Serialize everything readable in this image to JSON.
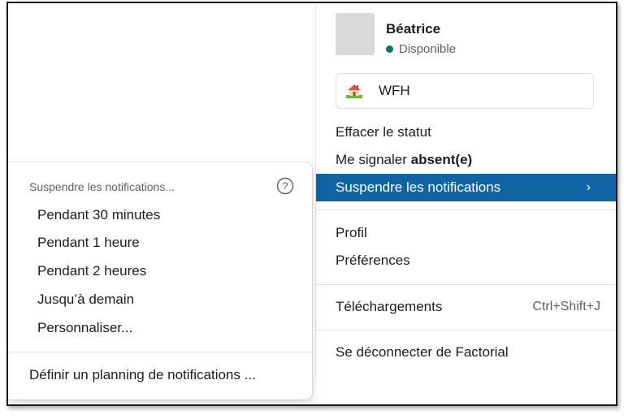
{
  "profile": {
    "name": "Béatrice",
    "presence": "Disponible",
    "presence_color": "#007a5a"
  },
  "status": {
    "emoji_icon": "house-emoji-icon",
    "text": "WFH"
  },
  "menu": {
    "clear_status": "Effacer le statut",
    "set_away_prefix": "Me signaler ",
    "set_away_bold": "absent(e)",
    "pause_notifications": "Suspendre les notifications",
    "profile": "Profil",
    "preferences": "Préférences",
    "downloads": "Téléchargements",
    "downloads_shortcut": "Ctrl+Shift+J",
    "sign_out": "Se déconnecter de Factorial"
  },
  "submenu": {
    "header": "Suspendre les notifications...",
    "options": [
      "Pendant 30 minutes",
      "Pendant 1 heure",
      "Pendant 2 heures",
      "Jusqu’à demain",
      "Personnaliser..."
    ],
    "schedule": "Définir un planning de notifications ..."
  },
  "colors": {
    "accent": "#1164a3"
  }
}
